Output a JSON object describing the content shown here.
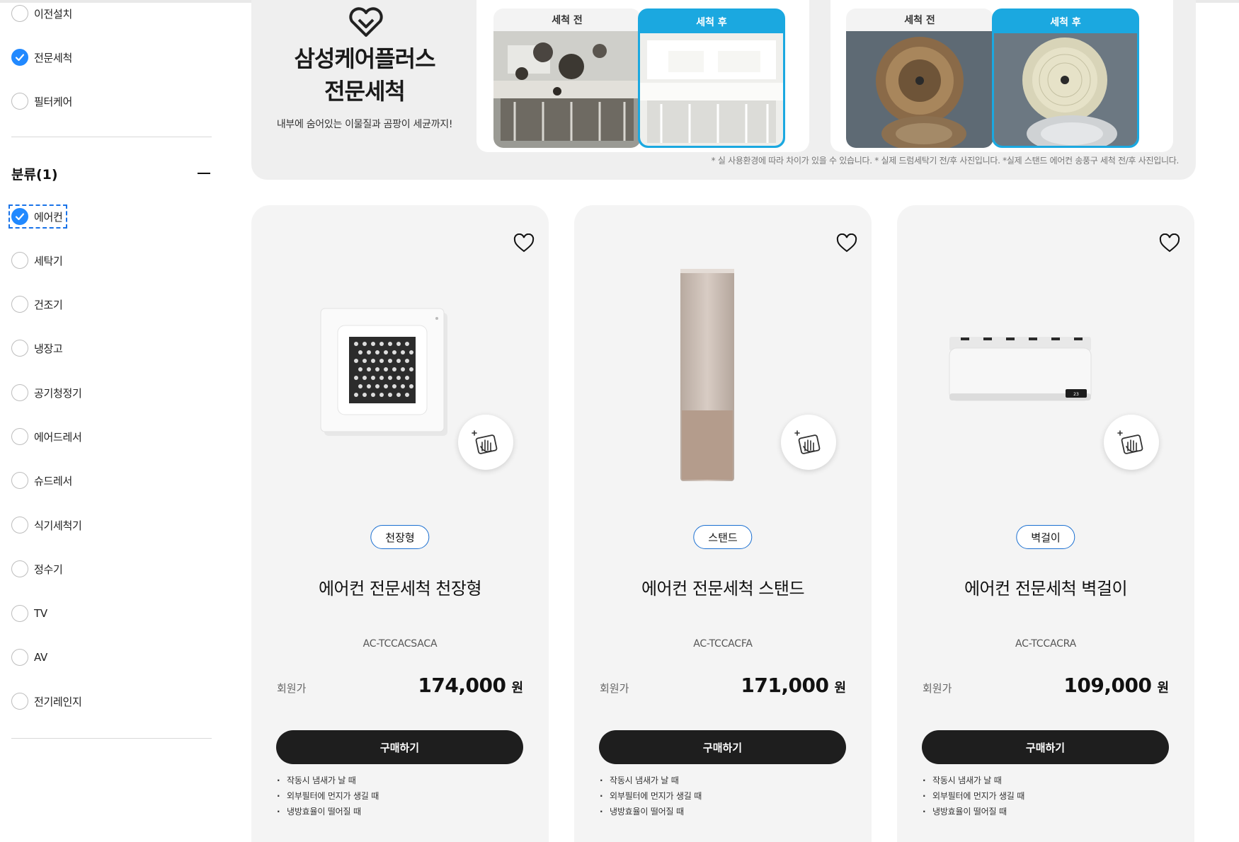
{
  "sidebar": {
    "service_filters": [
      {
        "label": "이전설치",
        "checked": false
      },
      {
        "label": "전문세척",
        "checked": true
      },
      {
        "label": "필터케어",
        "checked": false
      }
    ],
    "category": {
      "title": "분류(1)",
      "items": [
        {
          "label": "에어컨",
          "checked": true
        },
        {
          "label": "세탁기",
          "checked": false
        },
        {
          "label": "건조기",
          "checked": false
        },
        {
          "label": "냉장고",
          "checked": false
        },
        {
          "label": "공기청정기",
          "checked": false
        },
        {
          "label": "에어드레서",
          "checked": false
        },
        {
          "label": "슈드레서",
          "checked": false
        },
        {
          "label": "식기세척기",
          "checked": false
        },
        {
          "label": "정수기",
          "checked": false
        },
        {
          "label": "TV",
          "checked": false
        },
        {
          "label": "AV",
          "checked": false
        },
        {
          "label": "전기레인지",
          "checked": false
        }
      ]
    }
  },
  "banner": {
    "title_line1": "삼성케어플러스",
    "title_line2": "전문세척",
    "subtitle": "내부에 숨어있는 이물질과 곰팡이 세균까지!",
    "before_label": "세척 전",
    "after_label": "세척 후",
    "note": "* 실 사용환경에 따라 차이가 있을 수 있습니다. * 실제 드럼세탁기 전/후 사진입니다. *실제 스탠드 에어컨 송풍구 세척 전/후 사진입니다."
  },
  "products": [
    {
      "tag": "천장형",
      "name": "에어컨 전문세척 천장형",
      "model": "AC-TCCACSACA",
      "price_label": "회원가",
      "price": "174,000",
      "currency": "원",
      "buy_label": "구매하기"
    },
    {
      "tag": "스탠드",
      "name": "에어컨 전문세척 스탠드",
      "model": "AC-TCCACFA",
      "price_label": "회원가",
      "price": "171,000",
      "currency": "원",
      "buy_label": "구매하기"
    },
    {
      "tag": "벽걸이",
      "name": "에어컨 전문세척 벽걸이",
      "model": "AC-TCCACRA",
      "price_label": "회원가",
      "price": "109,000",
      "currency": "원",
      "buy_label": "구매하기"
    }
  ],
  "notes": [
    "작동시 냄새가 날 때",
    "외부필터에 먼지가 생길 때",
    "냉방효율이 떨어질 때"
  ],
  "colors": {
    "accent": "#2189ff",
    "after_frame": "#1ba8e0",
    "buy_button": "#1e1e1e",
    "tag_border": "#1a6fd1"
  }
}
